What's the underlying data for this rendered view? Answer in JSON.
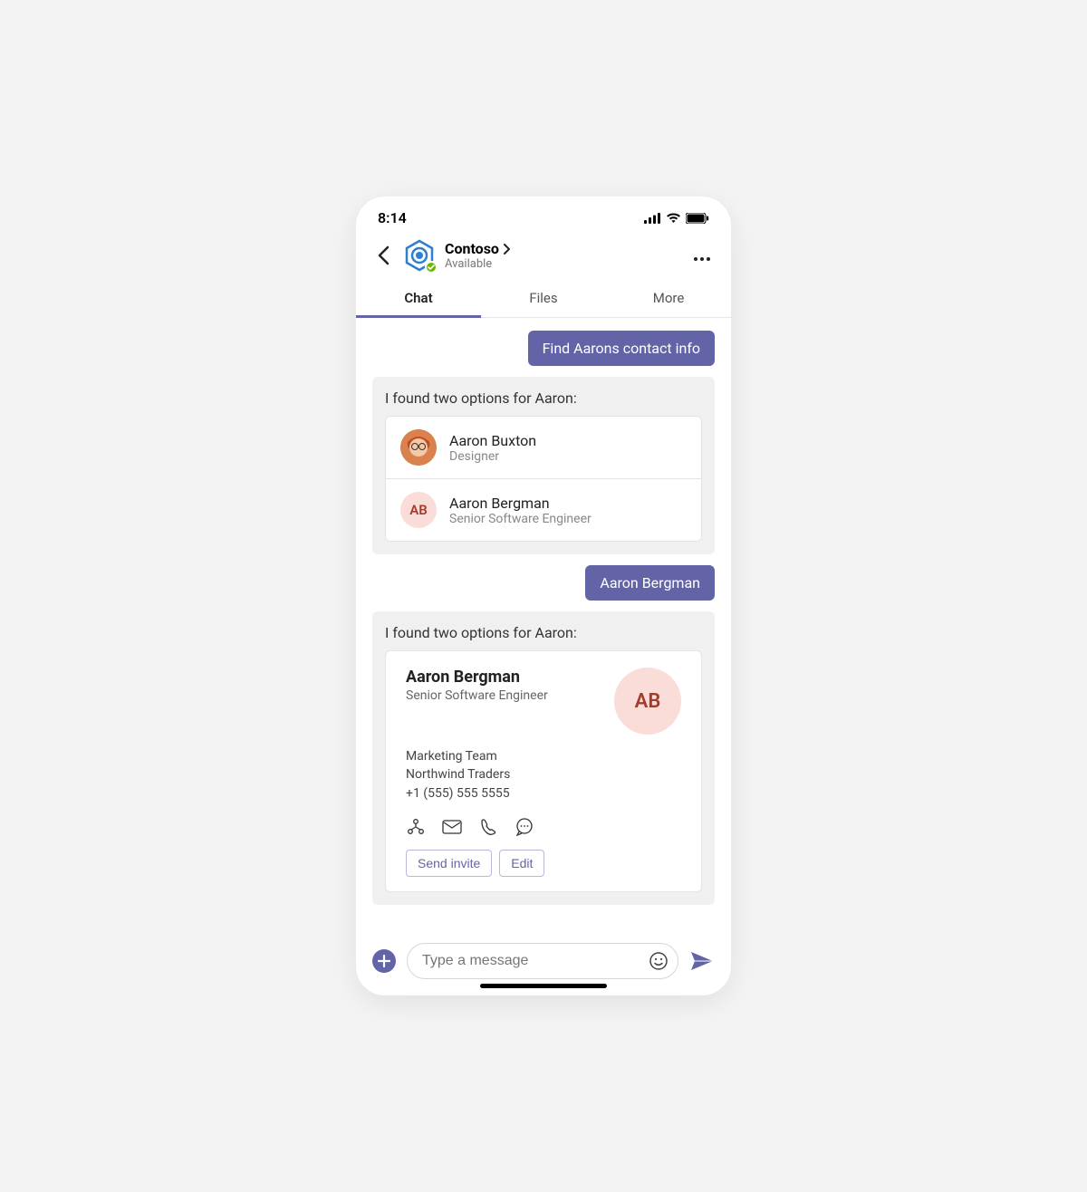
{
  "status": {
    "time": "8:14"
  },
  "header": {
    "title": "Contoso",
    "subtitle": "Available"
  },
  "tabs": [
    {
      "label": "Chat",
      "active": true
    },
    {
      "label": "Files",
      "active": false
    },
    {
      "label": "More",
      "active": false
    }
  ],
  "messages": {
    "user1": "Find Aarons contact info",
    "bot1": {
      "text": "I found two options for Aaron:",
      "options": [
        {
          "name": "Aaron Buxton",
          "role": "Designer",
          "initials": "AB",
          "photo": true
        },
        {
          "name": "Aaron Bergman",
          "role": "Senior Software Engineer",
          "initials": "AB",
          "photo": false
        }
      ]
    },
    "user2": "Aaron Bergman",
    "bot2": {
      "text": "I found two options for Aaron:",
      "contact": {
        "name": "Aaron Bergman",
        "role": "Senior Software Engineer",
        "team": "Marketing Team",
        "company": "Northwind Traders",
        "phone": "+1 (555) 555 5555",
        "initials": "AB",
        "actions": {
          "invite": "Send invite",
          "edit": "Edit"
        }
      }
    }
  },
  "composer": {
    "placeholder": "Type a message"
  }
}
